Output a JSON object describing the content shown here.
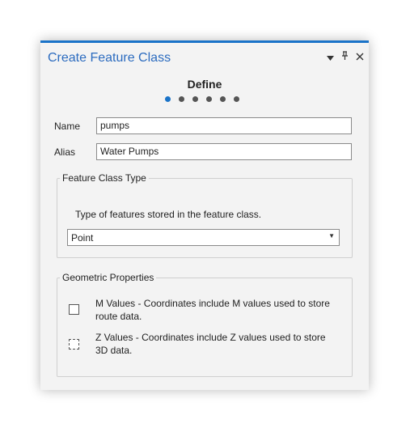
{
  "pane": {
    "title": "Create Feature Class",
    "menu_icon": "dropdown-arrow-icon",
    "pin_icon": "pin-icon",
    "close_icon": "close-icon"
  },
  "wizard": {
    "step_title": "Define",
    "total_steps": 6,
    "current_step": 1
  },
  "form": {
    "name_label": "Name",
    "name_value": "pumps",
    "alias_label": "Alias",
    "alias_value": "Water Pumps"
  },
  "feature_class_type": {
    "group_label": "Feature Class Type",
    "description": "Type of features stored in the feature class.",
    "selected": "Point"
  },
  "geometric_properties": {
    "group_label": "Geometric Properties",
    "m_values_label": "M Values - Coordinates include M values used to store route data.",
    "m_values_checked": false,
    "z_values_label": "Z Values - Coordinates include Z values used to store 3D data.",
    "z_values_checked": false
  },
  "colors": {
    "accent": "#1a73c8",
    "title_text": "#2b6bbf",
    "pane_background": "#f3f3f3"
  }
}
